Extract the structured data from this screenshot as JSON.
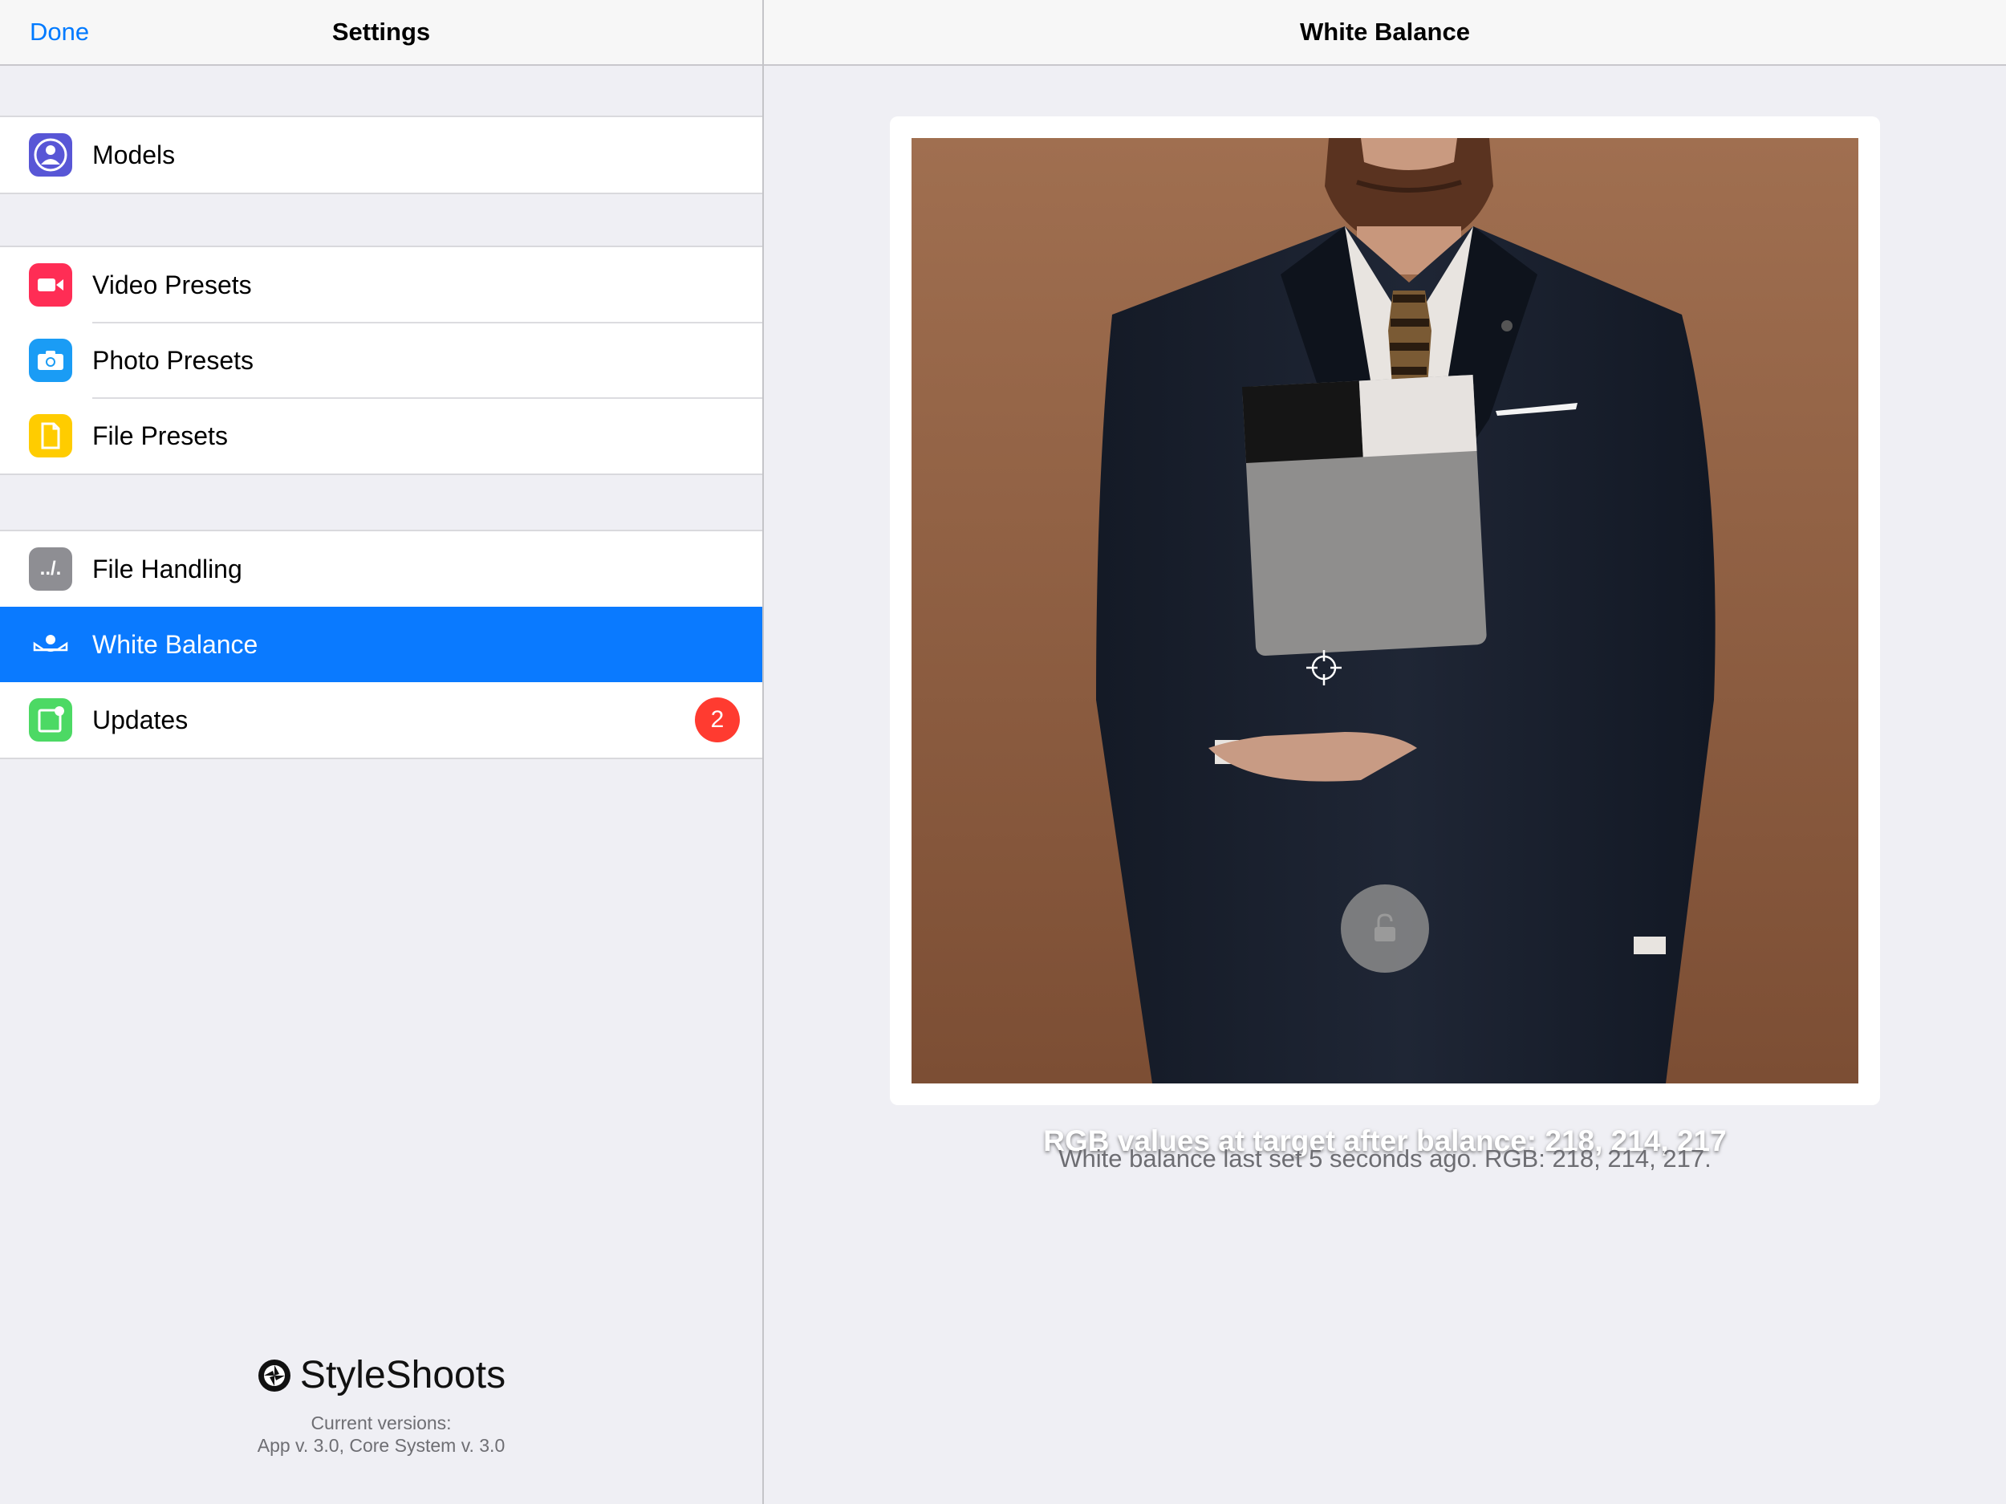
{
  "left_nav": {
    "done_label": "Done",
    "title": "Settings"
  },
  "right_nav": {
    "title": "White Balance"
  },
  "settings": {
    "group1": [
      {
        "label": "Models",
        "icon": "person-icon",
        "color": "#5856d6"
      }
    ],
    "group2": [
      {
        "label": "Video Presets",
        "icon": "video-camera-icon",
        "color": "#ff2d55"
      },
      {
        "label": "Photo Presets",
        "icon": "camera-icon",
        "color": "#1a9cf5"
      },
      {
        "label": "File Presets",
        "icon": "document-icon",
        "color": "#ffcc00"
      }
    ],
    "group3": [
      {
        "label": "File Handling",
        "icon": "file-path-icon",
        "color": "#8e8e93",
        "glyph": "../."
      },
      {
        "label": "White Balance",
        "icon": "white-balance-icon",
        "color": "#0a7aff",
        "selected": true
      },
      {
        "label": "Updates",
        "icon": "updates-icon",
        "color": "#4cd964",
        "badge": "2"
      }
    ]
  },
  "brand": {
    "name": "StyleShoots",
    "versions_label": "Current versions:",
    "versions": "App v. 3.0, Core System v. 3.0"
  },
  "white_balance": {
    "overlay_text": "RGB values at target after balance: 218, 214, 217",
    "caption": "White balance last set 5 seconds ago. RGB: 218, 214, 217."
  },
  "colors": {
    "accent": "#007aff",
    "selected_row": "#0a7aff",
    "badge": "#ff3b30"
  }
}
